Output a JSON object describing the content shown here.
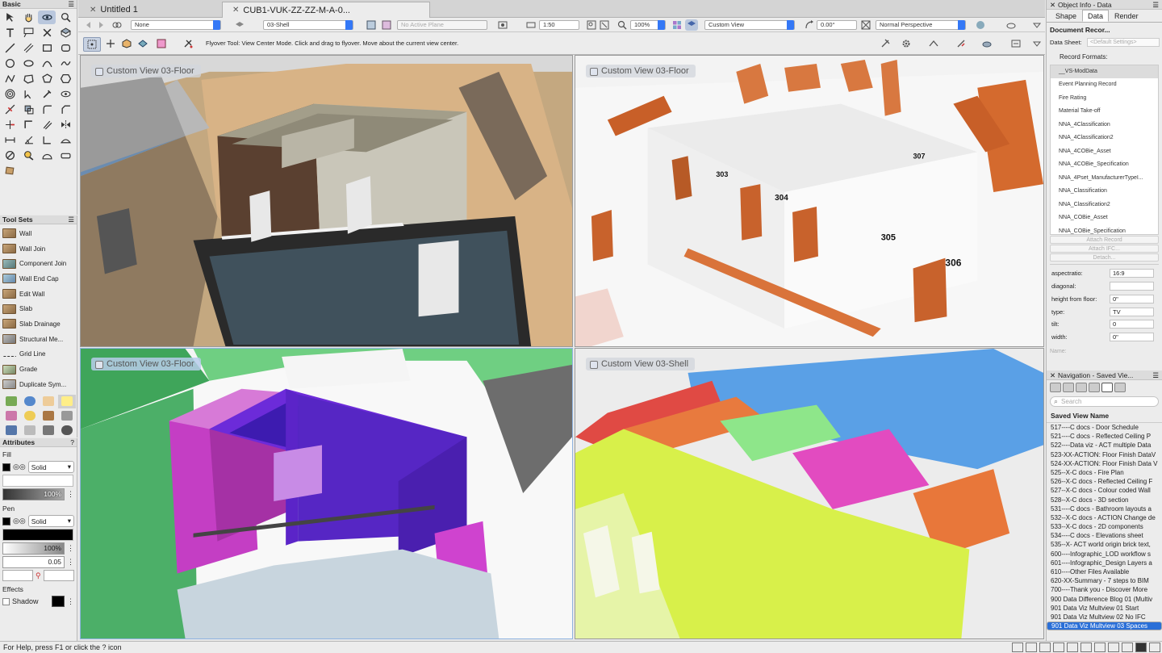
{
  "left_palettes": {
    "basic": {
      "title": "Basic",
      "menu_icon": "hamburger-icon"
    },
    "tool_sets": {
      "title": "Tool Sets",
      "items": [
        "Wall",
        "Wall Join",
        "Component Join",
        "Wall End Cap",
        "Edit Wall",
        "Slab",
        "Slab Drainage",
        "Structural Me...",
        "Grid Line",
        "Grade",
        "Duplicate Sym..."
      ]
    },
    "attributes": {
      "title": "Attributes",
      "fill_label": "Fill",
      "fill_style": "Solid",
      "fill_opacity": "100%",
      "pen_label": "Pen",
      "pen_style": "Solid",
      "pen_opacity": "100%",
      "line_weight": "0.05",
      "effects_label": "Effects",
      "shadow_label": "Shadow"
    }
  },
  "tabs": [
    {
      "label": "Untitled 1",
      "active": false
    },
    {
      "label": "CUB1-VUK-ZZ-ZZ-M-A-0...",
      "active": true
    }
  ],
  "view_bar": {
    "class_select": "None",
    "layer_select": "03-Shell",
    "plane_select": "No Active Plane",
    "scale": "1:50",
    "zoom": "100%",
    "view_select": "Custom View",
    "angle": "0.00°",
    "projection": "Normal Perspective"
  },
  "mode_bar": {
    "message": "Flyover Tool: View Center Mode. Click and drag to flyover.  Move about the current view center."
  },
  "viewports": [
    {
      "label": "Custom View  03-Floor"
    },
    {
      "label": "Custom View  03-Floor"
    },
    {
      "label": "Custom View  03-Floor"
    },
    {
      "label": "Custom View  03-Shell"
    }
  ],
  "scene_labels": {
    "r303": "303",
    "r304": "304",
    "r305": "305",
    "r306": "306",
    "r307": "307"
  },
  "object_info": {
    "title": "Object Info - Data",
    "tabs": [
      "Shape",
      "Data",
      "Render"
    ],
    "active_tab": "Data",
    "document_record": "Document Recor...",
    "data_sheet_label": "Data Sheet:",
    "data_sheet_value": "<Default Settings>",
    "record_formats_label": "Record Formats:",
    "records": [
      "__VS-ModData",
      "Event Planning Record",
      "Fire Rating",
      "Material Take-off",
      "NNA_4Classification",
      "NNA_4Classification2",
      "NNA_4COBie_Asset",
      "NNA_4COBie_Specification",
      "NNA_4Pset_ManufacturerTypeI...",
      "NNA_Classification",
      "NNA_Classification2",
      "NNA_COBie_Asset",
      "NNA_COBie_Specification"
    ],
    "buttons": [
      "Attach Record",
      "Attach IFC...",
      "Detach..."
    ],
    "fields": [
      {
        "label": "aspectratio:",
        "value": "16:9"
      },
      {
        "label": "diagonal:",
        "value": ""
      },
      {
        "label": "height from floor:",
        "value": "0\""
      },
      {
        "label": "type:",
        "value": "TV"
      },
      {
        "label": "tilt:",
        "value": "0"
      },
      {
        "label": "width:",
        "value": "0\""
      }
    ],
    "name_label": "Name:"
  },
  "navigation": {
    "title": "Navigation - Saved Vie...",
    "search_placeholder": "Search",
    "column_header": "Saved View Name",
    "items": [
      "517----C docs - Door Schedule",
      "521----C docs - Reflected Ceiling P",
      "522----Data viz - ACT multiple Data",
      "523-XX-ACTION: Floor Finish DataV",
      "524-XX-ACTION: Floor Finish Data V",
      "525--X-C docs - Fire Plan",
      "526--X-C docs - Reflected Ceiling F",
      "527--X-C docs - Colour coded Wall",
      "528--X-C docs - 3D section",
      "531----C docs - Bathroom layouts a",
      "532--X-C docs - ACTION Change de",
      "533--X-C docs - 2D components",
      "534----C docs - Elevations sheet",
      "535--X- ACT world origin brick text,",
      "600----Infographic_LOD workflow s",
      "601----Infographic_Design Layers a",
      "610----Other Files Available",
      "620-XX-Summary - 7 steps to BIM",
      "700----Thank you - Discover More",
      "900 Data Difference Blog 01 (Multiv",
      "901 Data Viz Multview 01 Start",
      "901 Data Viz Multview 02 No IFC",
      "901 Data Viz Multview 03 Spaces"
    ],
    "selected_index": 22
  },
  "status_bar": {
    "help_text": "For Help, press F1 or click the ? icon"
  }
}
